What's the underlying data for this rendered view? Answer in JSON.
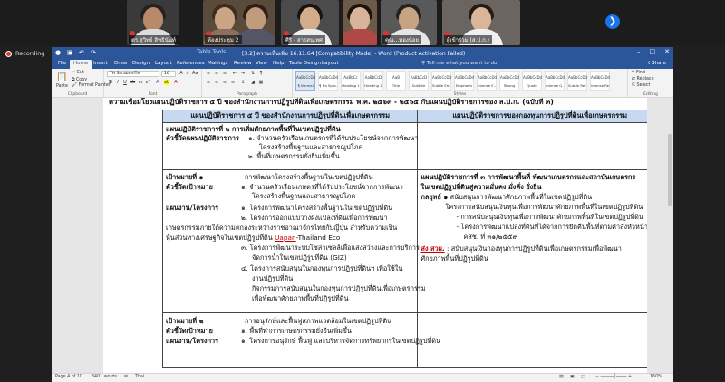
{
  "meeting": {
    "participants": [
      {
        "name": "ดร.สุวิทย์ สิทธินันท์"
      },
      {
        "name": "ห้องประชุม 2"
      },
      {
        "name": "ศิริ - สารสนเทศ"
      },
      {
        "name": ""
      },
      {
        "name": "คุณ...ทองน้อย"
      },
      {
        "name": "ผู้เข้าร่วม (ส.ป.ก.)"
      }
    ],
    "recording_label": "Recording",
    "next_icon": "chevron-right-icon"
  },
  "word": {
    "title": "[3.2] ความเห็นเพิ่ม 16.11.64 [Compatibility Mode] - Word (Product Activation Failed)",
    "context_tab": "Table Tools",
    "tabs": [
      "File",
      "Home",
      "Insert",
      "Draw",
      "Design",
      "Layout",
      "References",
      "Mailings",
      "Review",
      "View",
      "Help",
      "Table Design",
      "Layout"
    ],
    "active_tab": "Home",
    "tell_me": "Tell me what you want to do",
    "share": "Share",
    "ribbon": {
      "paste": "Paste",
      "cut": "Cut",
      "copy": "Copy",
      "format_painter": "Format Painter",
      "clipboard": "Clipboard",
      "font_name": "TH SarabunIT๙",
      "font_size": "16",
      "font_group": "Font",
      "paragraph_group": "Paragraph",
      "styles_group": "Styles",
      "editing_group": "Editing",
      "find": "Find",
      "replace": "Replace",
      "select": "Select",
      "styles": [
        {
          "preview": "AaBbCcDd",
          "name": "¶ Normal"
        },
        {
          "preview": "AaBbCcDd",
          "name": "¶ No Spac..."
        },
        {
          "preview": "AaBbCc",
          "name": "Heading 1"
        },
        {
          "preview": "AaBbCcD",
          "name": "Heading 2"
        },
        {
          "preview": "AaB",
          "name": "Title"
        },
        {
          "preview": "AaBbCcD",
          "name": "Subtitle"
        },
        {
          "preview": "AaBbCcDd",
          "name": "Subtle Em..."
        },
        {
          "preview": "AaBbCcDd",
          "name": "Emphasis"
        },
        {
          "preview": "AaBbCcDd",
          "name": "Intense E..."
        },
        {
          "preview": "AaBbCcDd",
          "name": "Strong"
        },
        {
          "preview": "AaBbCcDd",
          "name": "Quote"
        },
        {
          "preview": "AaBbCcDd",
          "name": "Intense Q..."
        },
        {
          "preview": "AaBbCcDd",
          "name": "Subtle Ref..."
        },
        {
          "preview": "AaBbCcDd",
          "name": "Intense Re..."
        }
      ]
    },
    "doc": {
      "top_line": "ความเชื่อมโยงแผนปฏิบัติราชการ ๕ ปี ของสำนักงานการปฏิรูปที่ดินเพื่อเกษตรกรรม พ.ศ. ๒๕๖๓ - ๒๕๖๕ กับแผนปฏิบัติราชการของ ส.ป.ก. (ฉบับที่ ๓)",
      "col_left_header": "แผนปฏิบัติราชการ ๕ ปี ของสำนักงานการปฏิรูปที่ดินเพื่อเกษตรกรรม",
      "col_right_header": "แผนปฏิบัติราชการของกองทุนการปฏิรูปที่ดินเพื่อเกษตรกรรม",
      "r1": {
        "l1": "แผนปฏิบัติราชการที่ ๒ การเพิ่มศักยภาพพื้นที่ในเขตปฏิรูปที่ดิน",
        "l2": "ตัวชี้วัดแผนปฏิบัติราชการ",
        "l3": "๑. จำนวนครัวเรือนเกษตรกรที่ได้รับประโยชน์จากการพัฒนา",
        "l4": "โครงสร้างพื้นฐานและสาธารณูปโภค",
        "l5": "๒. พื้นที่เกษตรกรรมยั่งยืนเพิ่มขึ้น"
      },
      "r2": {
        "goal": "เป้าหมายที่ ๑",
        "kpi": "ตัวชี้วัดเป้าหมาย",
        "plan": "แผนงาน/โครงการ",
        "g1": "การพัฒนาโครงสร้างพื้นฐานในเขตปฏิรูปที่ดิน",
        "g2": "๑. จำนวนครัวเรือนเกษตรที่ได้รับประโยชน์จากการพัฒนา",
        "g3": "โครงสร้างพื้นฐานและสาธารณูปโภค",
        "p1": "๑. โครงการพัฒนาโครงสร้างพื้นฐานในเขตปฏิรูปที่ดิน",
        "p2": "๒. โครงการออกแบบวางผังแปลงที่ดินเพื่อการพัฒนา",
        "p3": "เกษตรกรรมภายใต้ความตกลงระหว่างราชอาณาจักรไทยกับญี่ปุ่น สำหรับความเป็น",
        "p4a": "หุ้นส่วนทางเศรษฐกิจในเขตปฏิรูปที่ดิน ",
        "p4b": "Uapan",
        "p4c": "-Thailand Eco",
        "p5": "๓. โครงการพัฒนาระบบโซล่าเซลล์เพื่อแสงสว่างและการบริการ",
        "p6": "จัดการน้ำในเขตปฏิรูปที่ดิน (GIZ)",
        "p7": "๔. โครงการสนับสนุนในกองทุนการปฏิรูปที่ดินฯ เพื่อใช้ใน",
        "p8": "งานปฏิรูปที่ดิน",
        "p9": "กิจกรรมการสนับสนุนในกองทุนการปฏิรูปที่ดินเพื่อเกษตรกรรม",
        "p10": "เพื่อพัฒนาศักยภาพพื้นที่ปฏิรูปที่ดิน"
      },
      "r2_right": {
        "h1": "แผนปฏิบัติราชการที่ ๓ การพัฒนาพื้นที่ พัฒนาเกษตรกรและสถาบันเกษตรกร",
        "h2": "ในเขตปฏิรูปที่ดินสู่ความมั่นคง มั่งคั่ง ยั่งยืน",
        "k1a": "กลยุทธ์ ๑ ",
        "k1b": "สนับสนุนการพัฒนาศักยภาพพื้นที่ในเขตปฏิรูปที่ดิน",
        "k2": "โครงการสนับสนุนเงินทุนเพื่อการพัฒนาศักยภาพพื้นที่ในเขตปฏิรูปที่ดิน",
        "k3": "- การสนับสนุนเงินทุนเพื่อการพัฒนาศักยภาพพื้นที่ในเขตปฏิรูปที่ดิน",
        "k4": "- โครงการพัฒนาแปลงที่ดินที่ได้จากการยึดคืนพื้นที่ตามคำสั่งหัวหน้า",
        "k5": "คสช. ที่ ๓๑/๒๕๕๙",
        "k6a": "ส่ง สวผ.",
        "k6b": " : สนับสนุนเงินกองทุนการปฏิรูปที่ดินเพื่อเกษตรกรรมเพื่อพัฒนา",
        "k7": "ศักยภาพพื้นที่ปฏิรูปที่ดิน"
      },
      "r3": {
        "goal": "เป้าหมายที่ ๒",
        "kpi": "ตัวชี้วัดเป้าหมาย",
        "plan": "แผนงาน/โครงการ",
        "g1": "การอนุรักษ์และฟื้นฟูสภาพแวดล้อมในเขตปฏิรูปที่ดิน",
        "g2": "๑. พื้นที่ทำการเกษตรกรรมยั่งยืนเพิ่มขึ้น",
        "g3": "๑. โครงการอนุรักษ์ ฟื้นฟู และบริหารจัดการทรัพยากรในเขตปฏิรูปที่ดิน"
      }
    },
    "status": {
      "page": "Page 4 of 10",
      "words": "3401 words",
      "language": "Thai",
      "zoom": "160%"
    }
  }
}
